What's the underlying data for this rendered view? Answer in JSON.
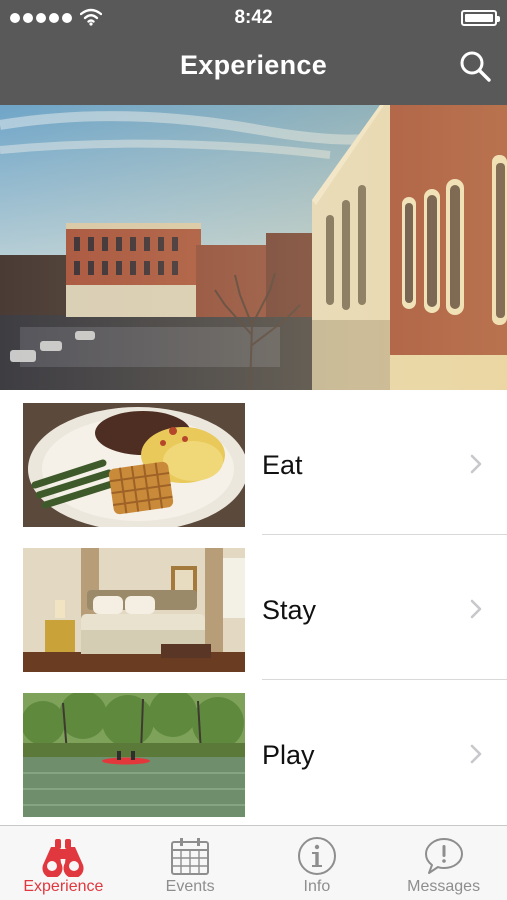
{
  "status_bar": {
    "time": "8:42"
  },
  "nav": {
    "title": "Experience",
    "search_icon": "search-icon"
  },
  "hero": {
    "image": "downtown-street-photo"
  },
  "categories": [
    {
      "label": "Eat",
      "image": "waffle-plate-photo"
    },
    {
      "label": "Stay",
      "image": "bedroom-photo"
    },
    {
      "label": "Play",
      "image": "river-kayak-photo"
    }
  ],
  "tabs": [
    {
      "label": "Experience",
      "icon": "binoculars-icon",
      "active": true
    },
    {
      "label": "Events",
      "icon": "calendar-icon",
      "active": false
    },
    {
      "label": "Info",
      "icon": "info-icon",
      "active": false
    },
    {
      "label": "Messages",
      "icon": "message-bubble-icon",
      "active": false
    }
  ],
  "colors": {
    "nav_bg": "#595959",
    "accent": "#e0383e",
    "tab_inactive": "#8e8e8e"
  }
}
